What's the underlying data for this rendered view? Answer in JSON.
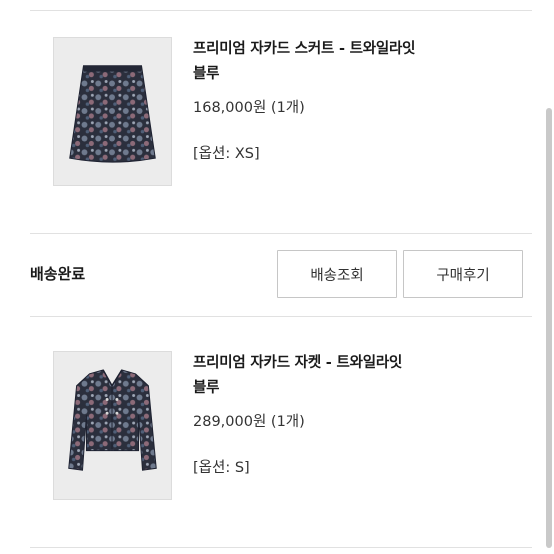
{
  "orders": [
    {
      "name_line1": "프리미엄 자카드 스커트 - 트와일라잇",
      "name_line2": "블루",
      "price": "168,000원 (1개)",
      "option": "[옵션: XS]",
      "image_icon": "skirt-image"
    },
    {
      "name_line1": "프리미엄 자카드 자켓 - 트와일라잇",
      "name_line2": "블루",
      "price": "289,000원 (1개)",
      "option": "[옵션: S]",
      "image_icon": "jacket-image"
    }
  ],
  "delivery": {
    "status": "배송완료",
    "track_label": "배송조회",
    "review_label": "구매후기"
  }
}
